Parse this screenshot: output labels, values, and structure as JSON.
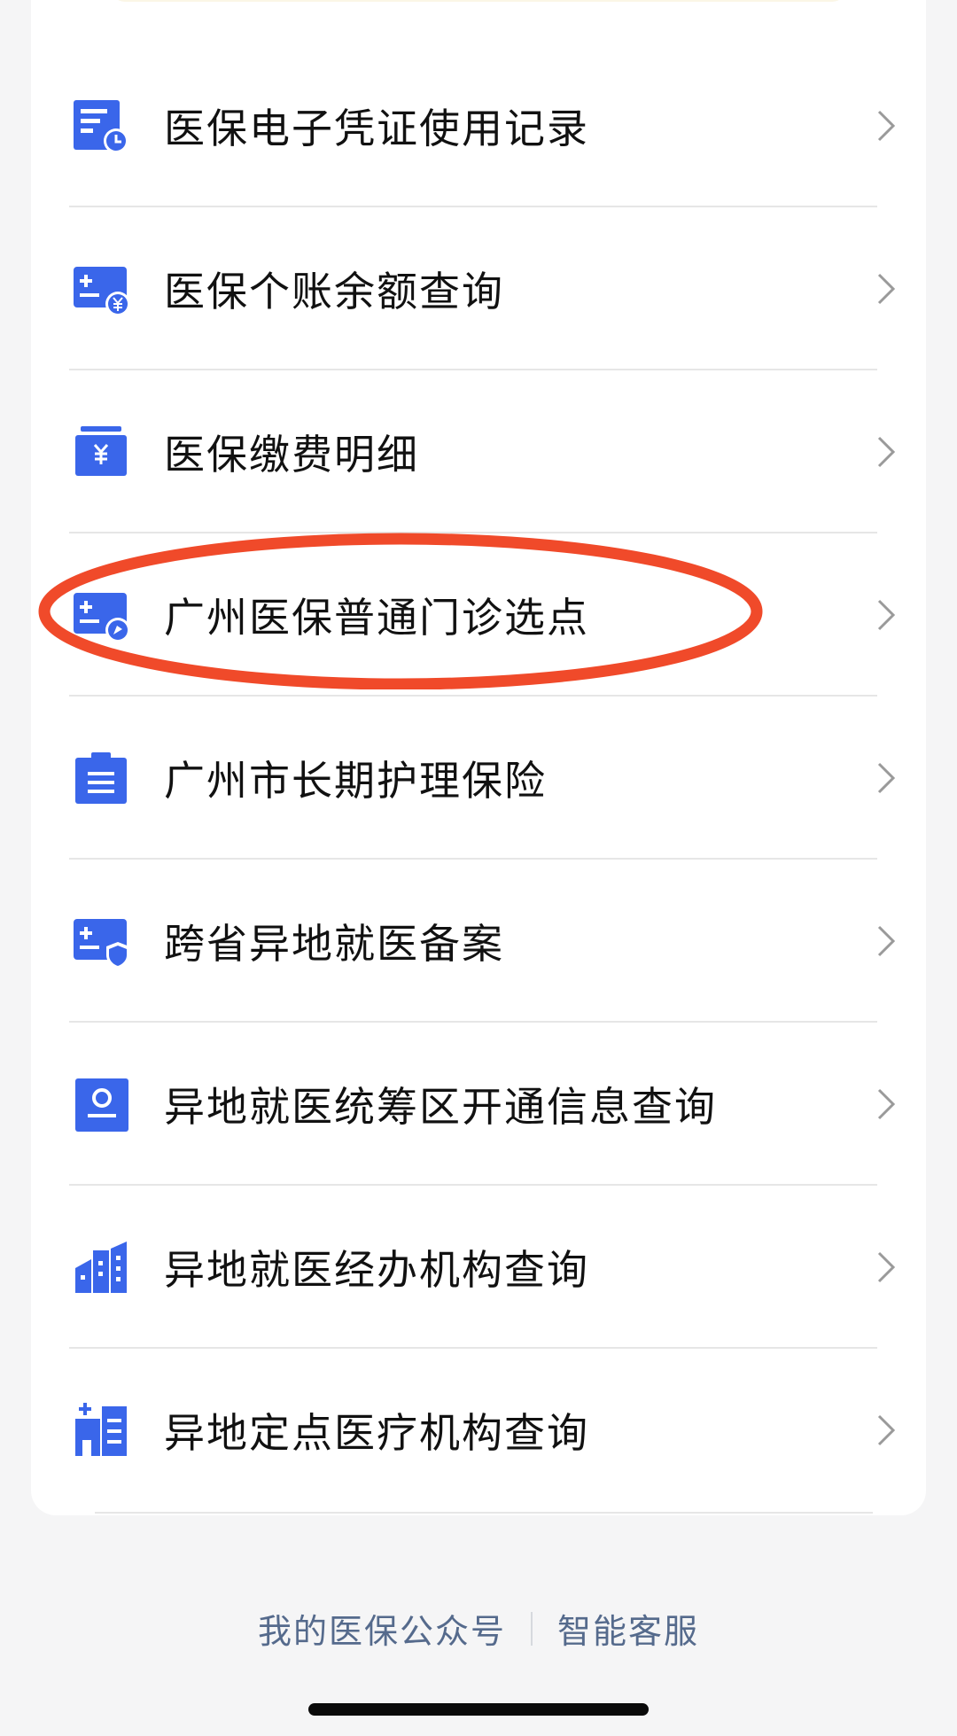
{
  "colors": {
    "icon_blue": "#3a66ea",
    "highlight_red": "#f04a2a",
    "footer_link": "#556a8c"
  },
  "menu": {
    "items": [
      {
        "label": "医保电子凭证使用记录",
        "icon": "document-clock-icon"
      },
      {
        "label": "医保个账余额查询",
        "icon": "card-yuan-icon"
      },
      {
        "label": "医保缴费明细",
        "icon": "wallet-yuan-icon"
      },
      {
        "label": "广州医保普通门诊选点",
        "icon": "card-pin-icon"
      },
      {
        "label": "广州市长期护理保险",
        "icon": "clipboard-icon"
      },
      {
        "label": "跨省异地就医备案",
        "icon": "card-shield-icon"
      },
      {
        "label": "异地就医统筹区开通信息查询",
        "icon": "profile-card-icon"
      },
      {
        "label": "异地就医经办机构查询",
        "icon": "buildings-icon"
      },
      {
        "label": "异地定点医疗机构查询",
        "icon": "hospital-icon"
      }
    ]
  },
  "footer": {
    "official_account": "我的医保公众号",
    "smart_service": "智能客服"
  }
}
